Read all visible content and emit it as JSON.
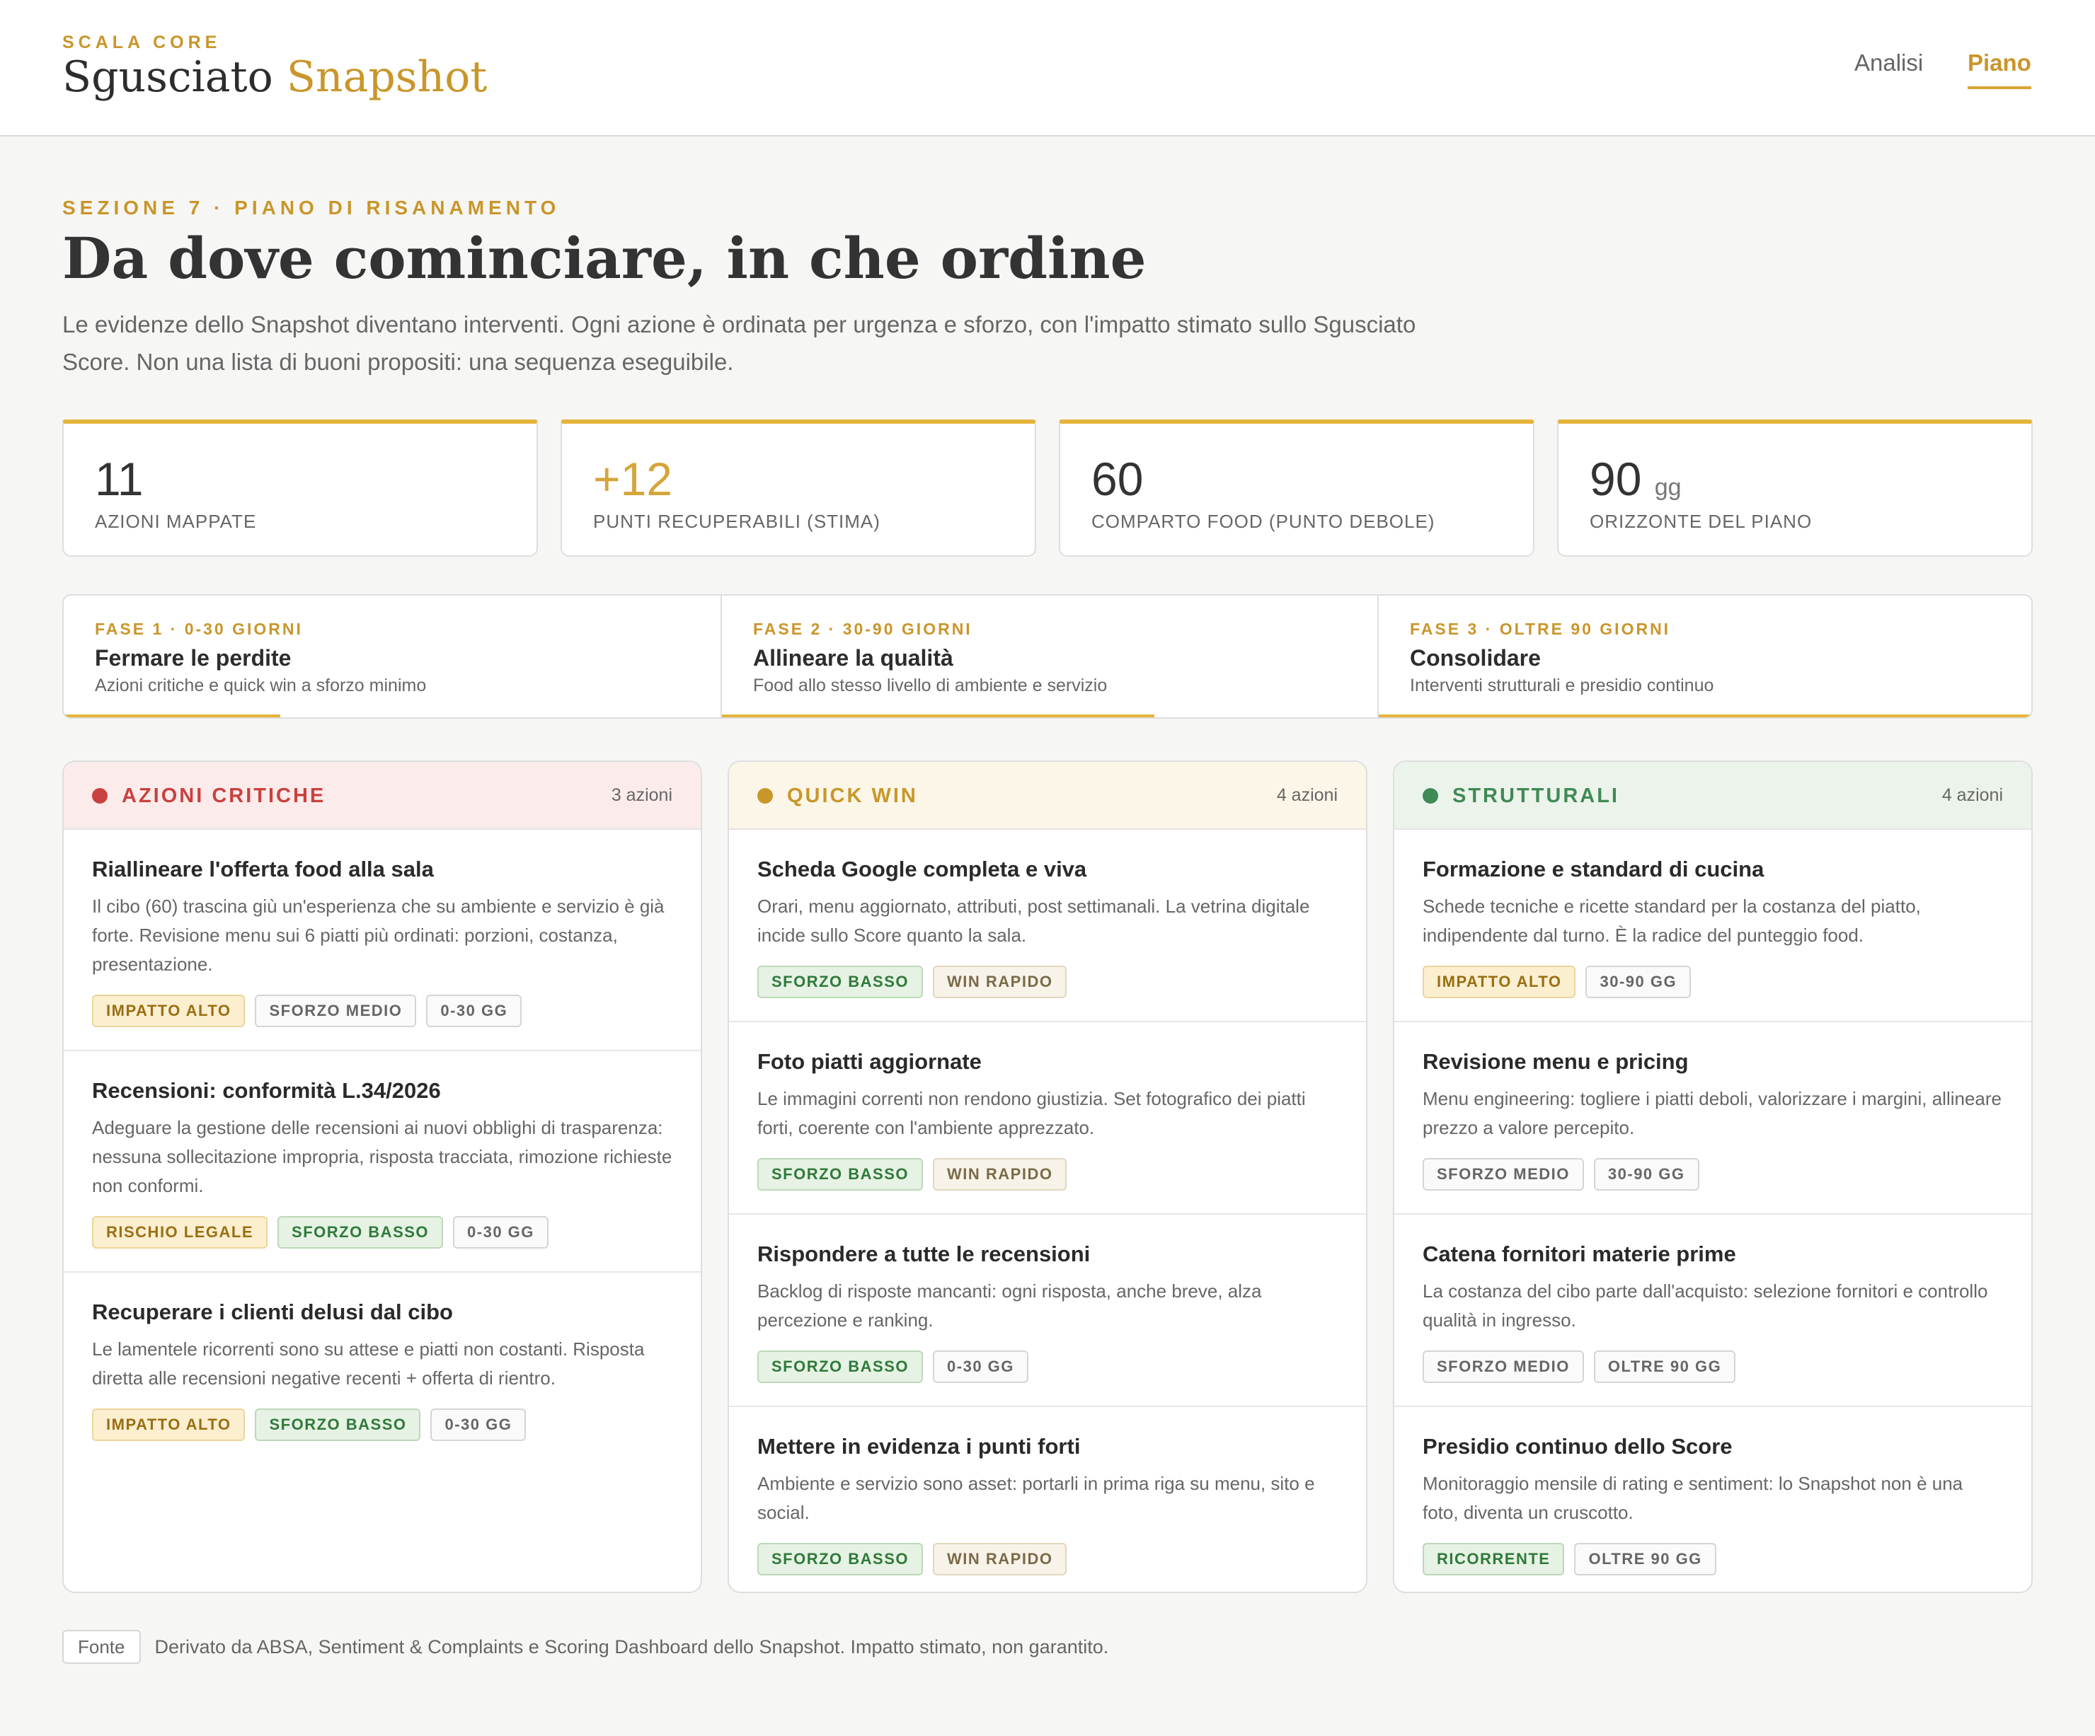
{
  "header": {
    "kicker": "SCALA CORE",
    "title_main": "Sgusciato",
    "title_accent": "Snapshot",
    "nav": [
      "Analisi",
      "Piano"
    ],
    "active_nav": "Piano"
  },
  "intro": {
    "kicker": "SEZIONE 7 · PIANO DI RISANAMENTO",
    "headline": "Da dove cominciare, in che ordine",
    "lead": "Le evidenze dello Snapshot diventano interventi. Ogni azione è ordinata per urgenza e sforzo, con l'impatto stimato sullo Sgusciato Score. Non una lista di buoni propositi: una sequenza eseguibile."
  },
  "kpis": [
    {
      "value": "11",
      "unit": "",
      "label": "AZIONI MAPPATE"
    },
    {
      "value": "+12",
      "unit": "",
      "label": "PUNTI RECUPERABILI (STIMA)"
    },
    {
      "value": "60",
      "unit": "",
      "label": "COMPARTO FOOD (PUNTO DEBOLE)"
    },
    {
      "value": "90",
      "unit": "gg",
      "label": "ORIZZONTE DEL PIANO"
    }
  ],
  "phases": [
    {
      "kicker": "FASE 1 · 0-30 GIORNI",
      "title": "Fermare le perdite",
      "subtitle": "Azioni critiche e quick win a sforzo minimo",
      "progress": 0.33
    },
    {
      "kicker": "FASE 2 · 30-90 GIORNI",
      "title": "Allineare la qualità",
      "subtitle": "Food allo stesso livello di ambiente e servizio",
      "progress": 0.66
    },
    {
      "kicker": "FASE 3 · OLTRE 90 GIORNI",
      "title": "Consolidare",
      "subtitle": "Interventi strutturali e presidio continuo",
      "progress": 1.0
    }
  ],
  "columns": {
    "critical": {
      "title": "AZIONI CRITICHE",
      "count": "3 azioni",
      "color": "#c9413f",
      "cards": [
        {
          "title": "Riallineare l'offerta food alla sala",
          "desc": "Il cibo (60) trascina giù un'esperienza che su ambiente e servizio è già forte. Revisione menu sui 6 piatti più ordinati: porzioni, costanza, presentazione.",
          "tags": [
            "IMPATTO ALTO",
            "SFORZO MEDIO",
            "0-30 GG"
          ]
        },
        {
          "title": "Recensioni: conformità L.34/2026",
          "desc": "Adeguare la gestione delle recensioni ai nuovi obblighi di trasparenza: nessuna sollecitazione impropria, risposta tracciata, rimozione richieste non conformi.",
          "tags": [
            "RISCHIO LEGALE",
            "SFORZO BASSO",
            "0-30 GG"
          ]
        },
        {
          "title": "Recuperare i clienti delusi dal cibo",
          "desc": "Le lamentele ricorrenti sono su attese e piatti non costanti. Risposta diretta alle recensioni negative recenti + offerta di rientro.",
          "tags": [
            "IMPATTO ALTO",
            "SFORZO BASSO",
            "0-30 GG"
          ]
        }
      ]
    },
    "quick": {
      "title": "QUICK WIN",
      "count": "4 azioni",
      "color": "#c9962a",
      "cards": [
        {
          "title": "Scheda Google completa e viva",
          "desc": "Orari, menu aggiornato, attributi, post settimanali. La vetrina digitale incide sullo Score quanto la sala.",
          "tags": [
            "SFORZO BASSO",
            "WIN RAPIDO"
          ]
        },
        {
          "title": "Foto piatti aggiornate",
          "desc": "Le immagini correnti non rendono giustizia. Set fotografico dei piatti forti, coerente con l'ambiente apprezzato.",
          "tags": [
            "SFORZO BASSO",
            "WIN RAPIDO"
          ]
        },
        {
          "title": "Rispondere a tutte le recensioni",
          "desc": "Backlog di risposte mancanti: ogni risposta, anche breve, alza percezione e ranking.",
          "tags": [
            "SFORZO BASSO",
            "0-30 GG"
          ]
        },
        {
          "title": "Mettere in evidenza i punti forti",
          "desc": "Ambiente e servizio sono asset: portarli in prima riga su menu, sito e social.",
          "tags": [
            "SFORZO BASSO",
            "WIN RAPIDO"
          ]
        }
      ]
    },
    "struct": {
      "title": "STRUTTURALI",
      "count": "4 azioni",
      "color": "#3f8a55",
      "cards": [
        {
          "title": "Formazione e standard di cucina",
          "desc": "Schede tecniche e ricette standard per la costanza del piatto, indipendente dal turno. È la radice del punteggio food.",
          "tags": [
            "IMPATTO ALTO",
            "30-90 GG"
          ]
        },
        {
          "title": "Revisione menu e pricing",
          "desc": "Menu engineering: togliere i piatti deboli, valorizzare i margini, allineare prezzo a valore percepito.",
          "tags": [
            "SFORZO MEDIO",
            "30-90 GG"
          ]
        },
        {
          "title": "Catena fornitori materie prime",
          "desc": "La costanza del cibo parte dall'acquisto: selezione fornitori e controllo qualità in ingresso.",
          "tags": [
            "SFORZO MEDIO",
            "OLTRE 90 GG"
          ]
        },
        {
          "title": "Presidio continuo dello Score",
          "desc": "Monitoraggio mensile di rating e sentiment: lo Snapshot non è una foto, diventa un cruscotto.",
          "tags": [
            "RICORRENTE",
            "OLTRE 90 GG"
          ]
        }
      ]
    }
  },
  "footer": {
    "badge": "Fonte",
    "text": "Derivato da ABSA, Sentiment & Complaints e Scoring Dashboard dello Snapshot. Impatto stimato, non garantito."
  }
}
